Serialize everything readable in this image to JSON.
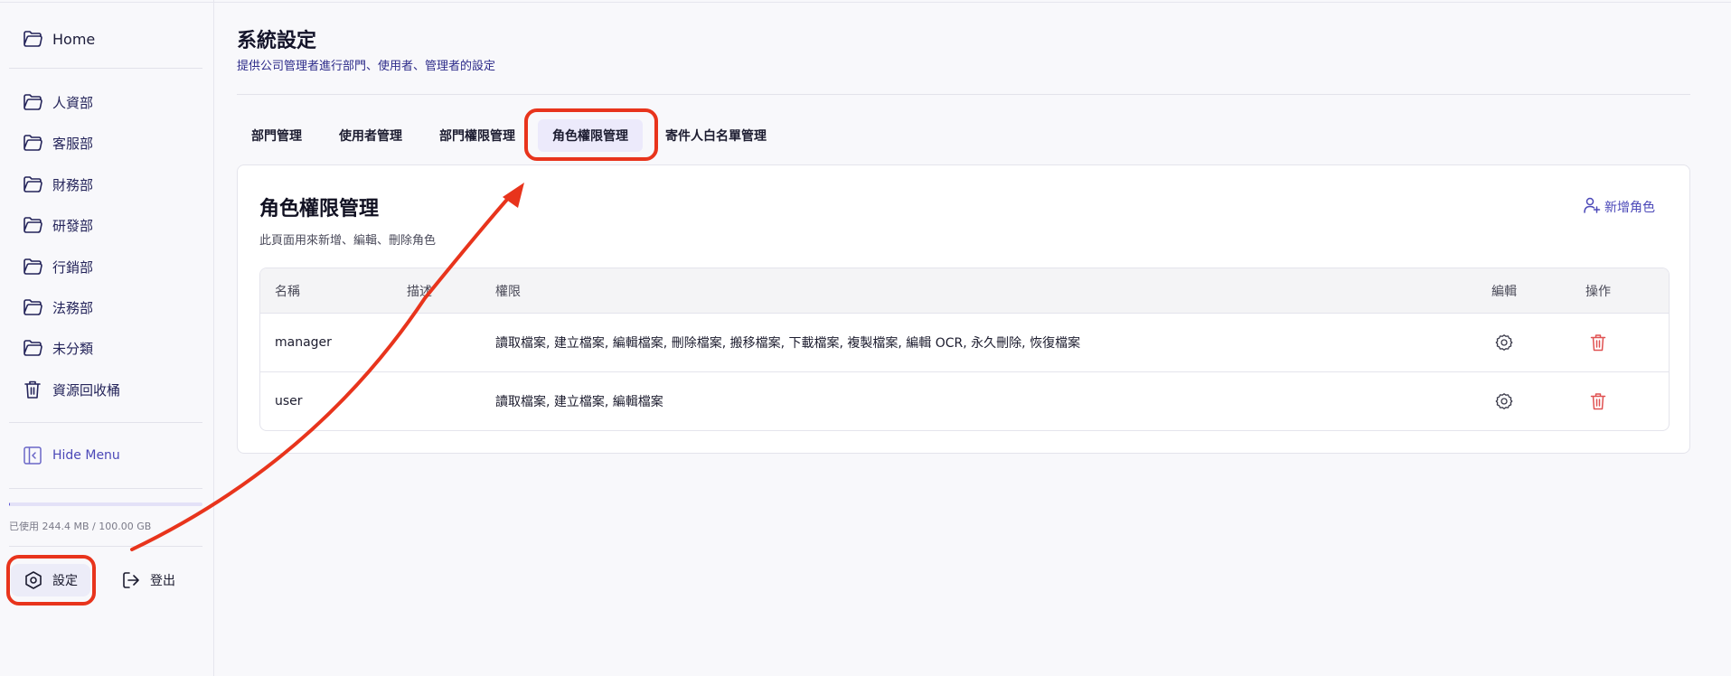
{
  "sidebar": {
    "home_label": "Home",
    "departments": [
      {
        "label": "人資部"
      },
      {
        "label": "客服部"
      },
      {
        "label": "財務部"
      },
      {
        "label": "研發部"
      },
      {
        "label": "行銷部"
      },
      {
        "label": "法務部"
      },
      {
        "label": "未分類"
      }
    ],
    "recycle_label": "資源回收桶",
    "hide_menu_label": "Hide Menu",
    "usage_text": "已使用 244.4 MB / 100.00 GB",
    "usage_fraction": 0.0024,
    "settings_label": "設定",
    "logout_label": "登出"
  },
  "page": {
    "title": "系統設定",
    "subtitle": "提供公司管理者進行部門、使用者、管理者的設定"
  },
  "tabs": [
    {
      "label": "部門管理",
      "active": false
    },
    {
      "label": "使用者管理",
      "active": false
    },
    {
      "label": "部門權限管理",
      "active": false
    },
    {
      "label": "角色權限管理",
      "active": true
    },
    {
      "label": "寄件人白名單管理",
      "active": false
    }
  ],
  "card": {
    "title": "角色權限管理",
    "subtitle": "此頁面用來新增、編輯、刪除角色",
    "add_button_label": "新增角色",
    "columns": {
      "name": "名稱",
      "desc": "描述",
      "perm": "權限",
      "edit": "編輯",
      "op": "操作"
    },
    "rows": [
      {
        "name": "manager",
        "desc": "",
        "permissions": "讀取檔案, 建立檔案, 編輯檔案, 刪除檔案, 搬移檔案, 下載檔案, 複製檔案, 編輯 OCR, 永久刪除, 恢復檔案"
      },
      {
        "name": "user",
        "desc": "",
        "permissions": "讀取檔案, 建立檔案, 編輯檔案"
      }
    ]
  },
  "colors": {
    "accent": "#4b48b8",
    "annotation": "#e8341c",
    "delete": "#e05252"
  }
}
